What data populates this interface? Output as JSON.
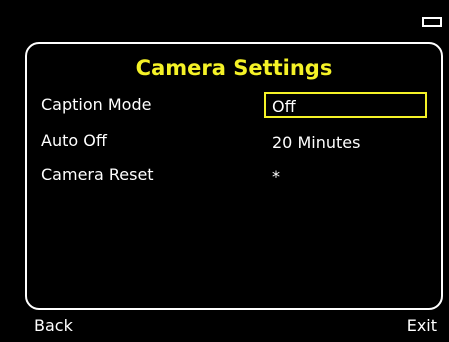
{
  "status_bar": {
    "battery_icon": "battery-icon"
  },
  "panel": {
    "title": "Camera Settings",
    "title_color": "#f5f227",
    "selection_color": "#f5f227",
    "rows": [
      {
        "label": "Caption Mode",
        "value": "Off",
        "selected": true
      },
      {
        "label": "Auto Off",
        "value": "20 Minutes",
        "selected": false
      },
      {
        "label": "Camera Reset",
        "value": "*",
        "selected": false
      }
    ]
  },
  "footer": {
    "back_label": "Back",
    "exit_label": "Exit"
  }
}
